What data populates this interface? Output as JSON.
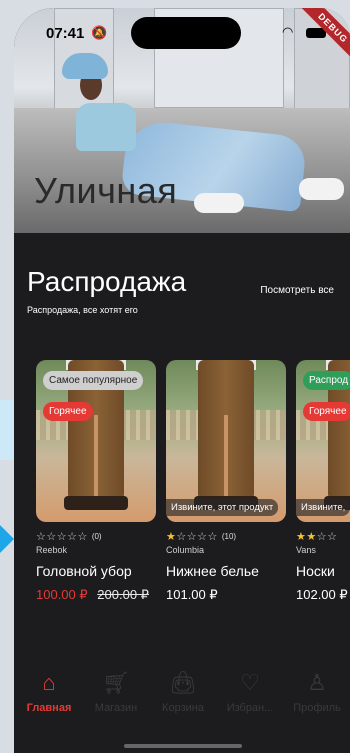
{
  "status_bar": {
    "time": "07:41"
  },
  "debug_ribbon": "DEBUG",
  "hero": {
    "title": "Уличная"
  },
  "sale": {
    "title": "Распродажа",
    "subtitle": "Распродажа, все хотят его",
    "see_all": "Посмотреть все"
  },
  "products": [
    {
      "chips": [
        "Самое популярное",
        "Горячее"
      ],
      "rating": 0,
      "stars": 5,
      "reviews": "(0)",
      "brand": "Reebok",
      "name": "Головной убор",
      "price": "100.00 ₽",
      "old_price": "200.00 ₽"
    },
    {
      "overlay": "Извините, этот продукт",
      "rating": 1,
      "stars": 5,
      "reviews": "(10)",
      "brand": "Columbia",
      "name": "Нижнее белье",
      "price": "101.00 ₽"
    },
    {
      "chips": [
        "Распрод",
        "Горячее"
      ],
      "overlay": "Извините,",
      "rating": 2,
      "brand": "Vans",
      "name": "Носки",
      "price": "102.00 ₽"
    }
  ],
  "tabs": [
    {
      "label": "Главная",
      "icon": "home-icon",
      "active": true
    },
    {
      "label": "Магазин",
      "icon": "cart-icon"
    },
    {
      "label": "Корзина",
      "icon": "bag-icon"
    },
    {
      "label": "Избран...",
      "icon": "heart-icon"
    },
    {
      "label": "Профиль",
      "icon": "profile-icon"
    }
  ],
  "colors": {
    "accent": "#e53935",
    "background": "#1c1c1e",
    "chip_green": "#2e9e58"
  }
}
